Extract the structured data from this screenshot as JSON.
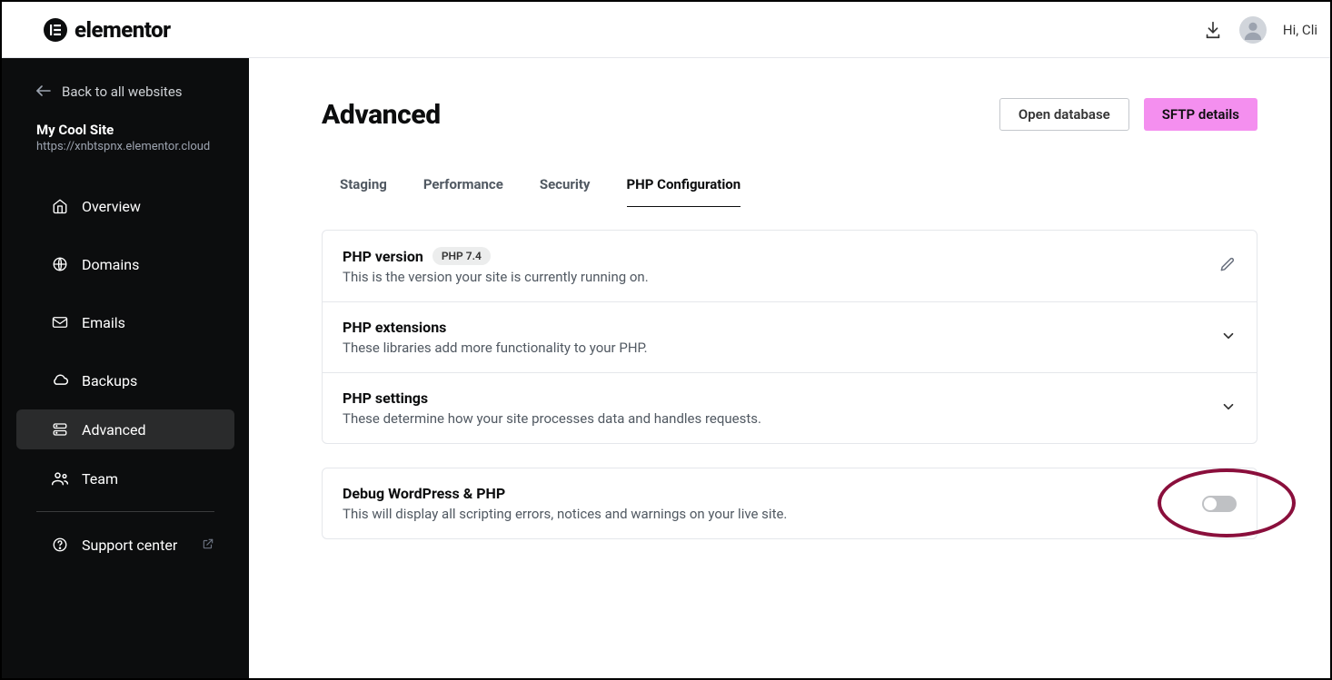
{
  "brand": {
    "name": "elementor",
    "mark": "E"
  },
  "topbar": {
    "greeting": "Hi, Cli"
  },
  "sidebar": {
    "back_label": "Back to all websites",
    "site_name": "My Cool Site",
    "site_url": "https://xnbtspnx.elementor.cloud",
    "items": [
      {
        "label": "Overview"
      },
      {
        "label": "Domains"
      },
      {
        "label": "Emails"
      },
      {
        "label": "Backups"
      },
      {
        "label": "Advanced"
      },
      {
        "label": "Team"
      },
      {
        "label": "Support center"
      }
    ]
  },
  "page": {
    "title": "Advanced",
    "open_database_label": "Open database",
    "sftp_label": "SFTP details"
  },
  "tabs": [
    {
      "label": "Staging"
    },
    {
      "label": "Performance"
    },
    {
      "label": "Security"
    },
    {
      "label": "PHP Configuration"
    }
  ],
  "php": {
    "version_title": "PHP version",
    "version_badge": "PHP 7.4",
    "version_desc": "This is the version your site is currently running on.",
    "extensions_title": "PHP extensions",
    "extensions_desc": "These libraries add more functionality to your PHP.",
    "settings_title": "PHP settings",
    "settings_desc": "These determine how your site processes data and handles requests.",
    "debug_title": "Debug WordPress & PHP",
    "debug_desc": "This will display all scripting errors, notices and warnings on your live site."
  }
}
